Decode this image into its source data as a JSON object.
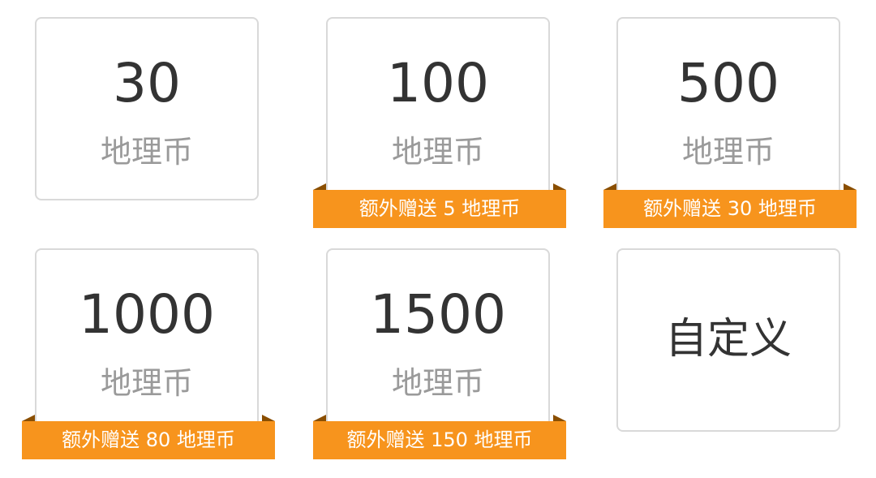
{
  "unit_label": "地理币",
  "packages": [
    {
      "amount": "30"
    },
    {
      "amount": "100",
      "bonus": "额外赠送 5 地理币"
    },
    {
      "amount": "500",
      "bonus": "额外赠送 30 地理币"
    },
    {
      "amount": "1000",
      "bonus": "额外赠送 80 地理币"
    },
    {
      "amount": "1500",
      "bonus": "额外赠送 150 地理币"
    }
  ],
  "custom_label": "自定义",
  "colors": {
    "bonus_bg": "#f7941d",
    "border": "#d9d9d9",
    "amount_text": "#333333",
    "unit_text": "#9a9a9a"
  }
}
